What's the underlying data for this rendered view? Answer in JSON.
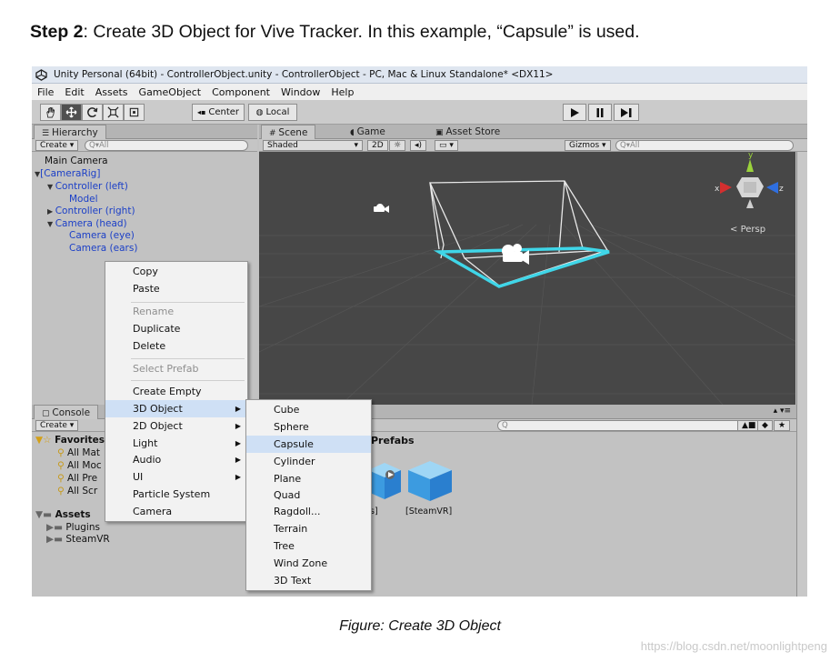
{
  "heading": {
    "bold": "Step 2",
    "text": ": Create 3D Object for Vive Tracker. In this example, “Capsule” is used."
  },
  "window": {
    "title": "Unity Personal (64bit) - ControllerObject.unity - ControllerObject - PC, Mac & Linux Standalone* <DX11>"
  },
  "menubar": [
    "File",
    "Edit",
    "Assets",
    "GameObject",
    "Component",
    "Window",
    "Help"
  ],
  "toolbar": {
    "center_label": "Center",
    "local_label": "Local"
  },
  "hierarchy": {
    "tab": "Hierarchy",
    "create": "Create",
    "search_placeholder": "Q▾All",
    "items": [
      "Main Camera",
      "[CameraRig]",
      "Controller (left)",
      "Model",
      "Controller (right)",
      "Camera (head)",
      "Camera (eye)",
      "Camera (ears)"
    ]
  },
  "scene": {
    "tabs": [
      "Scene",
      "Game",
      "Asset Store"
    ],
    "shading": "Shaded",
    "mode_2d": "2D",
    "gizmos": "Gizmos",
    "search_placeholder": "Q▾All",
    "persp": "Persp",
    "axes": {
      "x": "x",
      "y": "y",
      "z": "z"
    }
  },
  "console": {
    "tab": "Console",
    "create": "Create",
    "favorites_label": "Favorites",
    "favorites": [
      "All Mat",
      "All Moc",
      "All Pre",
      "All Scr"
    ],
    "assets_label": "Assets",
    "asset_folders": [
      "Plugins",
      "SteamVR"
    ],
    "prefabs_header": "Prefabs",
    "prefab_items": [
      "s]",
      "[SteamVR]"
    ]
  },
  "context_menu": {
    "items": [
      "Copy",
      "Paste",
      "Rename",
      "Duplicate",
      "Delete",
      "Select Prefab",
      "Create Empty",
      "3D Object",
      "2D Object",
      "Light",
      "Audio",
      "UI",
      "Particle System",
      "Camera"
    ]
  },
  "submenu": {
    "items": [
      "Cube",
      "Sphere",
      "Capsule",
      "Cylinder",
      "Plane",
      "Quad",
      "Ragdoll...",
      "Terrain",
      "Tree",
      "Wind Zone",
      "3D Text"
    ]
  },
  "caption": "Figure: Create 3D Object",
  "watermark": "https://blog.csdn.net/moonlightpeng",
  "colors": {
    "highlight": "#cfe0f5",
    "scene_bg": "#474747",
    "selection_cyan": "#3fd6e8",
    "hierarchy_blue": "#1b3fc7"
  },
  "icons": [
    "unity-logo-icon",
    "hand-tool-icon",
    "move-tool-icon",
    "rotate-tool-icon",
    "scale-tool-icon",
    "rect-tool-icon",
    "play-icon",
    "pause-icon",
    "step-icon",
    "camera-gizmo-icon",
    "folder-icon",
    "search-icon",
    "prefab-cube-icon"
  ]
}
